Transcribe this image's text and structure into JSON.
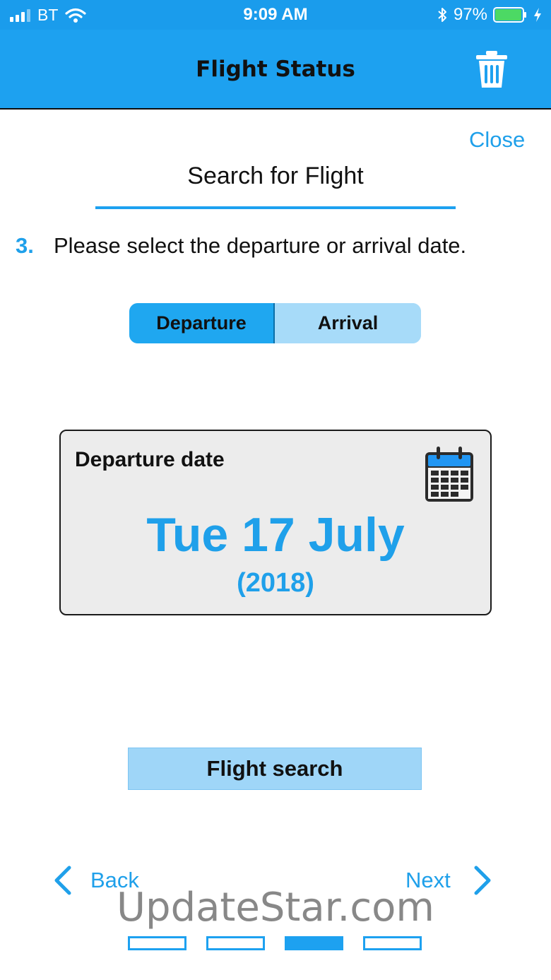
{
  "status_bar": {
    "carrier": "BT",
    "time": "9:09 AM",
    "battery_percent": "97%",
    "battery_level": 0.97
  },
  "nav": {
    "title": "Flight Status",
    "trash_icon": "trash-icon"
  },
  "close_label": "Close",
  "section_title": "Search for Flight",
  "step": {
    "number": "3.",
    "text": "Please select the departure or arrival date."
  },
  "segments": {
    "departure": "Departure",
    "arrival": "Arrival",
    "selected": "departure"
  },
  "date_card": {
    "label": "Departure date",
    "date": "Tue 17 July",
    "year": "(2018)",
    "icon": "calendar-icon"
  },
  "search_button": "Flight search",
  "footer": {
    "back": "Back",
    "next": "Next"
  },
  "watermark": "UpdateStar.com",
  "pager": {
    "total": 4,
    "current_index": 2
  },
  "colors": {
    "accent": "#1da1f0",
    "link": "#1fa0ea",
    "segment_selected": "#1fa7f0",
    "segment_unselected": "#a7dbf9",
    "card_background": "#ececec",
    "search_button": "#9fd6f8"
  }
}
